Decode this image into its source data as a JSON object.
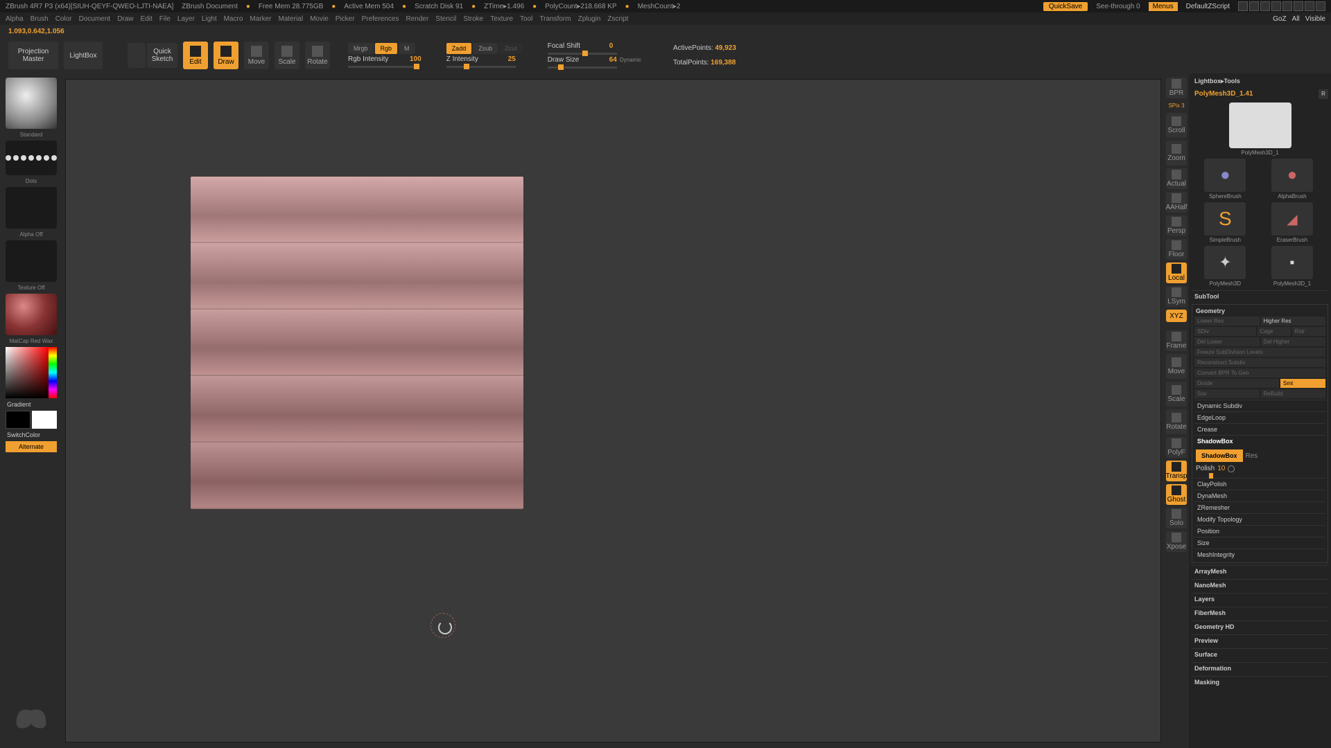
{
  "title_bar": {
    "app": "ZBrush 4R7 P3 (x64)[SIUH-QEYF-QWEO-LJTI-NAEA]",
    "doc": "ZBrush Document",
    "free_mem": "Free Mem 28.775GB",
    "active_mem": "Active Mem 504",
    "scratch": "Scratch Disk 91",
    "ztime": "ZTime▸1.496",
    "polycount": "PolyCount▸218.668 KP",
    "meshcount": "MeshCount▸2",
    "quicksave": "QuickSave",
    "see_through": "See-through  0",
    "menus": "Menus",
    "default_script": "DefaultZScript"
  },
  "menu_bar": {
    "items": [
      "Alpha",
      "Brush",
      "Color",
      "Document",
      "Draw",
      "Edit",
      "File",
      "Layer",
      "Light",
      "Macro",
      "Marker",
      "Material",
      "Movie",
      "Picker",
      "Preferences",
      "Render",
      "Stencil",
      "Stroke",
      "Texture",
      "Tool",
      "Transform",
      "Zplugin",
      "Zscript"
    ],
    "right": {
      "goz": "GoZ",
      "all": "All",
      "visible": "Visible"
    }
  },
  "coords": "1.093,0.642,1.056",
  "shelf": {
    "projection": "Projection",
    "master": "Master",
    "lightbox": "LightBox",
    "quick": "Quick",
    "sketch": "Sketch",
    "modes": [
      "Edit",
      "Draw",
      "Move",
      "Scale",
      "Rotate"
    ],
    "mrgb": "Mrgb",
    "rgb": "Rgb",
    "m": "M",
    "zadd": "Zadd",
    "zsub": "Zsub",
    "zcut": "Zcut",
    "rgb_int_lbl": "Rgb Intensity",
    "rgb_int_val": "100",
    "z_int_lbl": "Z Intensity",
    "z_int_val": "25",
    "focal_lbl": "Focal Shift",
    "focal_val": "0",
    "draw_lbl": "Draw Size",
    "draw_val": "64",
    "dynamic": "Dynamic",
    "active_pts_lbl": "ActivePoints:",
    "active_pts_val": "49,923",
    "total_pts_lbl": "TotalPoints:",
    "total_pts_val": "169,388"
  },
  "left": {
    "brush": "Standard",
    "stroke": "Dots",
    "alpha": "Alpha Off",
    "texture": "Texture Off",
    "material": "MatCap Red Wax",
    "gradient": "Gradient",
    "switch": "SwitchColor",
    "alternate": "Alternate"
  },
  "nav": {
    "spix": "SPix 3",
    "items": [
      "BPR",
      "Scroll",
      "Zoom",
      "Actual",
      "AAHalf",
      "Persp",
      "Floor",
      "Local",
      "LSym",
      "XYZ",
      "Frame",
      "Move",
      "Scale",
      "Rotate",
      "PolyF",
      "Transp",
      "Ghost",
      "Solo",
      "Xpose"
    ]
  },
  "right": {
    "title": "Lightbox▸Tools",
    "tool_name": "PolyMesh3D_1.41",
    "r": "R",
    "thumbs": [
      "PolyMesh3D_1",
      "SphereBrush",
      "AlphaBrush",
      "SimpleBrush",
      "EraserBrush",
      "PolyMesh3D",
      "PolyMesh3D_1"
    ],
    "subtool": "SubTool",
    "geometry": "Geometry",
    "lower_res": "Lower Res",
    "higher_res": "Higher Res",
    "sdiv": "SDiv",
    "cage": "Cage",
    "rstr": "Rstr",
    "del_lower": "Del Lower",
    "del_higher": "Del Higher",
    "freeze": "Freeze SubDivision Levels",
    "reconstruct": "Reconstruct Subdiv",
    "convert": "Convert BPR To Geo",
    "divide": "Divide",
    "smt": "Smt",
    "suv": "Suv",
    "rebuild": "ReBuild",
    "dyn_subdiv": "Dynamic Subdiv",
    "edgeloop": "EdgeLoop",
    "crease": "Crease",
    "shadowbox_head": "ShadowBox",
    "shadowbox_btn": "ShadowBox",
    "res": "Res",
    "polish_lbl": "Polish",
    "polish_val": "10",
    "claypolish": "ClayPolish",
    "dynamesh": "DynaMesh",
    "zremesher": "ZRemesher",
    "modify_topo": "Modify Topology",
    "position": "Position",
    "size": "Size",
    "meshint": "MeshIntegrity",
    "arraymesh": "ArrayMesh",
    "nanomesh": "NanoMesh",
    "layers": "Layers",
    "fibermesh": "FiberMesh",
    "geohd": "Geometry HD",
    "preview": "Preview",
    "surface": "Surface",
    "deformation": "Deformation",
    "masking": "Masking"
  }
}
